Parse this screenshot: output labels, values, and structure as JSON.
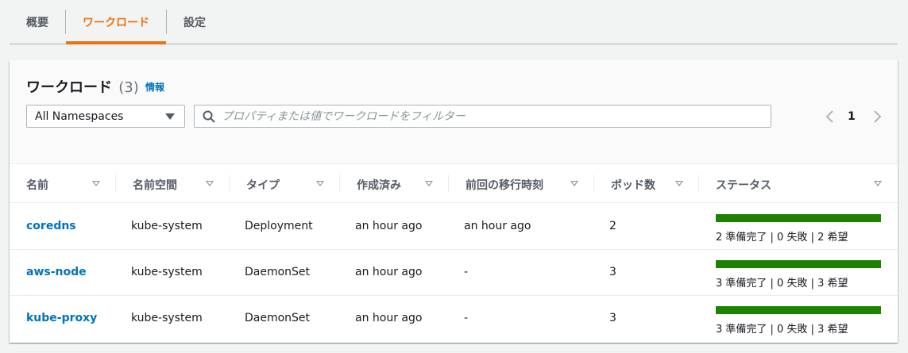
{
  "tabs": [
    {
      "label": "概要"
    },
    {
      "label": "ワークロード"
    },
    {
      "label": "設定"
    }
  ],
  "workloads": {
    "title": "ワークロード",
    "count": "(3)",
    "info_label": "情報",
    "namespace_select": {
      "value": "All Namespaces"
    },
    "filter": {
      "placeholder": "プロパティまたは値でワークロードをフィルター"
    },
    "pagination": {
      "current_page": "1"
    },
    "columns": [
      "名前",
      "名前空間",
      "タイプ",
      "作成済み",
      "前回の移行時刻",
      "ポッド数",
      "ステータス"
    ],
    "rows": [
      {
        "name": "coredns",
        "namespace": "kube-system",
        "type": "Deployment",
        "created": "an hour ago",
        "last_transition": "an hour ago",
        "pods": "2",
        "ready_fraction": 1.0,
        "status_text": "2 準備完了 | 0 失敗 | 2 希望"
      },
      {
        "name": "aws-node",
        "namespace": "kube-system",
        "type": "DaemonSet",
        "created": "an hour ago",
        "last_transition": "-",
        "pods": "3",
        "ready_fraction": 1.0,
        "status_text": "3 準備完了 | 0 失敗 | 3 希望"
      },
      {
        "name": "kube-proxy",
        "namespace": "kube-system",
        "type": "DaemonSet",
        "created": "an hour ago",
        "last_transition": "-",
        "pods": "3",
        "ready_fraction": 1.0,
        "status_text": "3 準備完了 | 0 失敗 | 3 希望"
      }
    ]
  },
  "colors": {
    "accent": "#ec7211",
    "link": "#0073bb",
    "success": "#1d8102"
  }
}
